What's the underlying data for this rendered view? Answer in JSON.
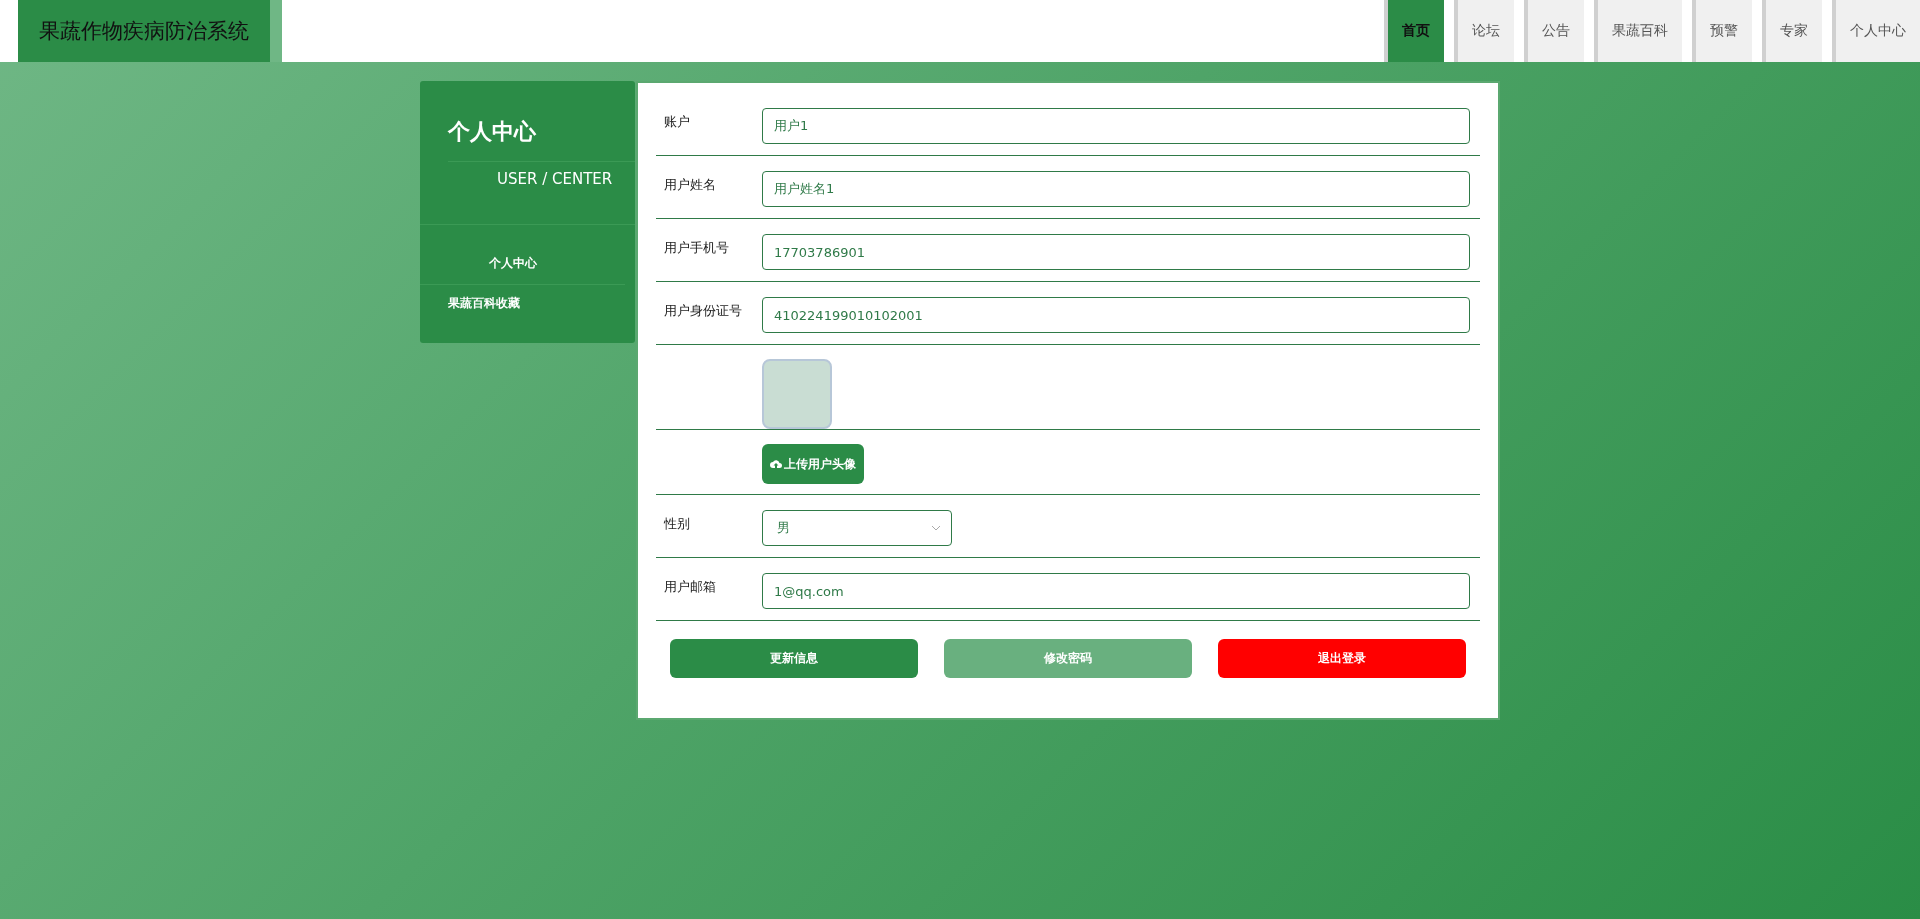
{
  "header": {
    "title": "果蔬作物疾病防治系统",
    "nav": [
      {
        "label": "首页",
        "selected": true
      },
      {
        "label": "论坛",
        "selected": false
      },
      {
        "label": "公告",
        "selected": false
      },
      {
        "label": "果蔬百科",
        "selected": false
      },
      {
        "label": "预警",
        "selected": false
      },
      {
        "label": "专家",
        "selected": false
      },
      {
        "label": "个人中心",
        "selected": false
      }
    ]
  },
  "sidebar": {
    "title": "个人中心",
    "subtitle": "USER / CENTER",
    "items": [
      {
        "label": "个人中心",
        "selected": true
      },
      {
        "label": "果蔬百科收藏",
        "selected": false
      }
    ]
  },
  "form": {
    "fields": [
      {
        "kind": "text",
        "label": "账户",
        "value": "用户1"
      },
      {
        "kind": "text",
        "label": "用户姓名",
        "value": "用户姓名1"
      },
      {
        "kind": "text",
        "label": "用户手机号",
        "value": "17703786901"
      },
      {
        "kind": "text",
        "label": "用户身份证号",
        "value": "410224199010102001"
      },
      {
        "kind": "image",
        "button": "上传用户头像"
      },
      {
        "kind": "select",
        "label": "性别",
        "value": "男"
      },
      {
        "kind": "text",
        "label": "用户邮箱",
        "value": "1@qq.com"
      }
    ],
    "buttons": [
      {
        "label": "更新信息",
        "color": "#2b8c47"
      },
      {
        "label": "修改密码",
        "color": "#69b07f"
      },
      {
        "label": "退出登录",
        "color": "#ff0000"
      }
    ]
  }
}
